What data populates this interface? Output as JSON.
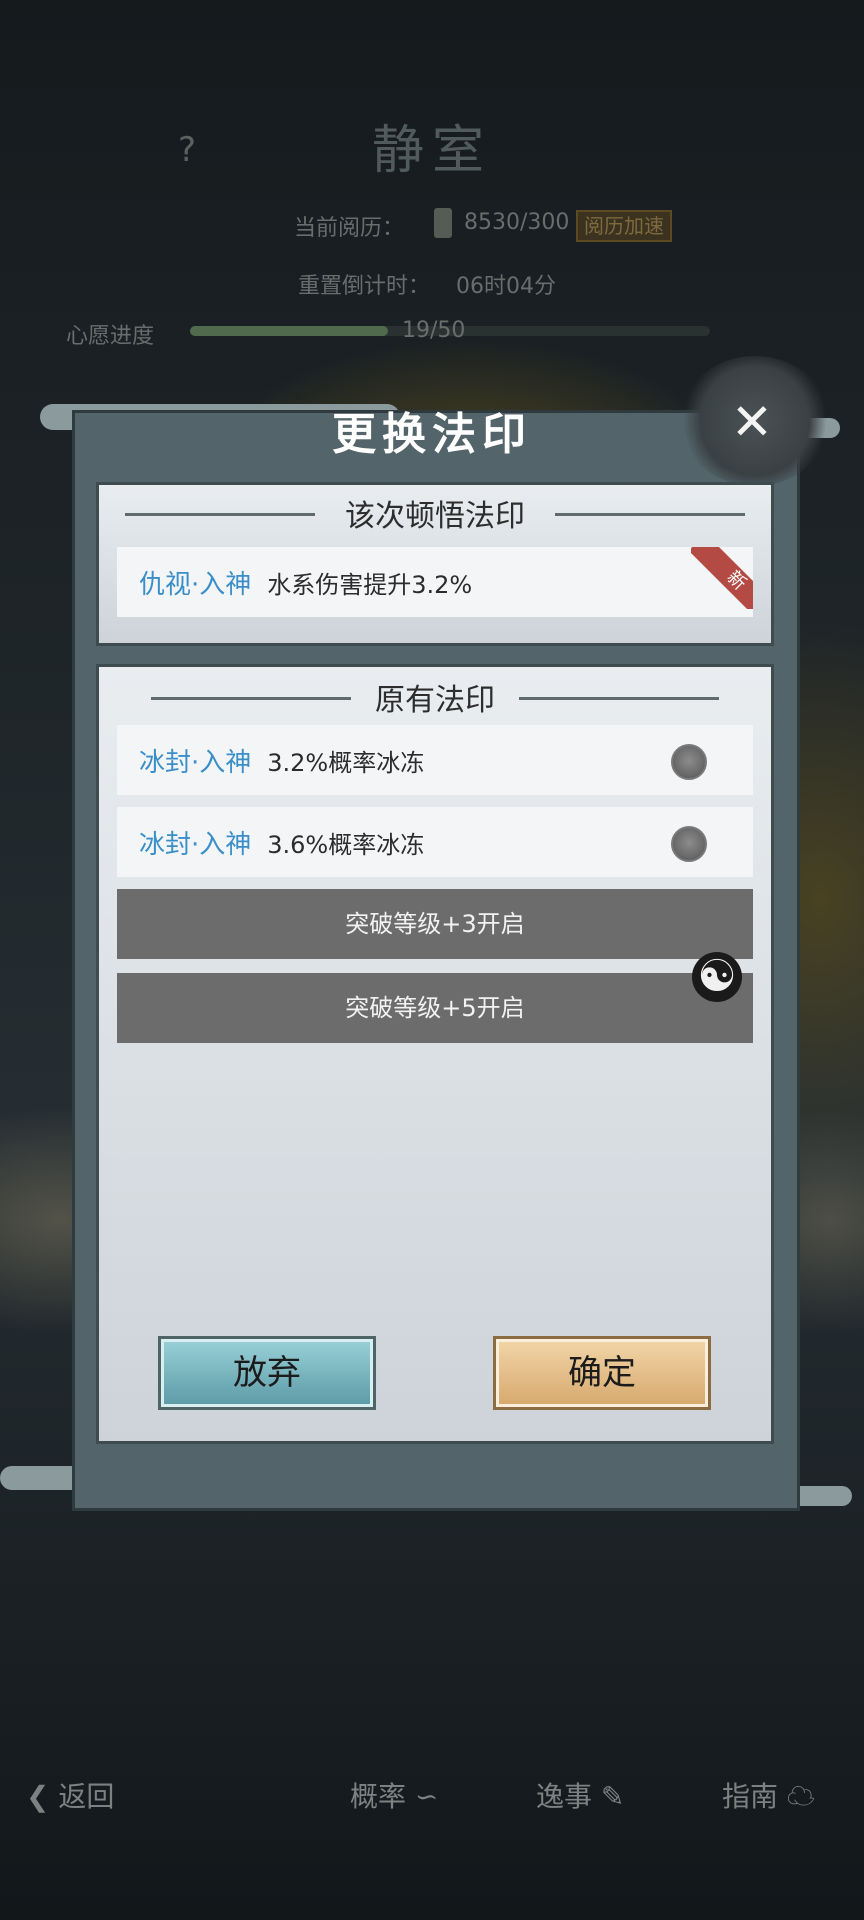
{
  "background": {
    "help_icon": "?",
    "title": "静室",
    "experience_label": "当前阅历：",
    "experience_value": "8530/300",
    "speedup_label": "阅历加速",
    "reset_label": "重置倒计时：",
    "reset_value": "06时04分",
    "wish_label": "心愿进度",
    "wish_value": "19/50",
    "wish_progress": 0.38
  },
  "modal": {
    "title": "更换法印",
    "close_icon": "✕",
    "section_new": {
      "heading": "该次顿悟法印",
      "item": {
        "name": "仇视·入神",
        "desc": "水系伤害提升3.2%",
        "badge": "新"
      }
    },
    "section_existing": {
      "heading": "原有法印",
      "items": [
        {
          "name": "冰封·入神",
          "desc": "3.2%概率冰冻"
        },
        {
          "name": "冰封·入神",
          "desc": "3.6%概率冰冻"
        }
      ],
      "locked": [
        "突破等级+3开启",
        "突破等级+5开启"
      ]
    },
    "buttons": {
      "abandon": "放弃",
      "confirm": "确定"
    }
  },
  "bottom_nav": {
    "back": "返回",
    "items": [
      "概率",
      "逸事",
      "指南"
    ]
  }
}
